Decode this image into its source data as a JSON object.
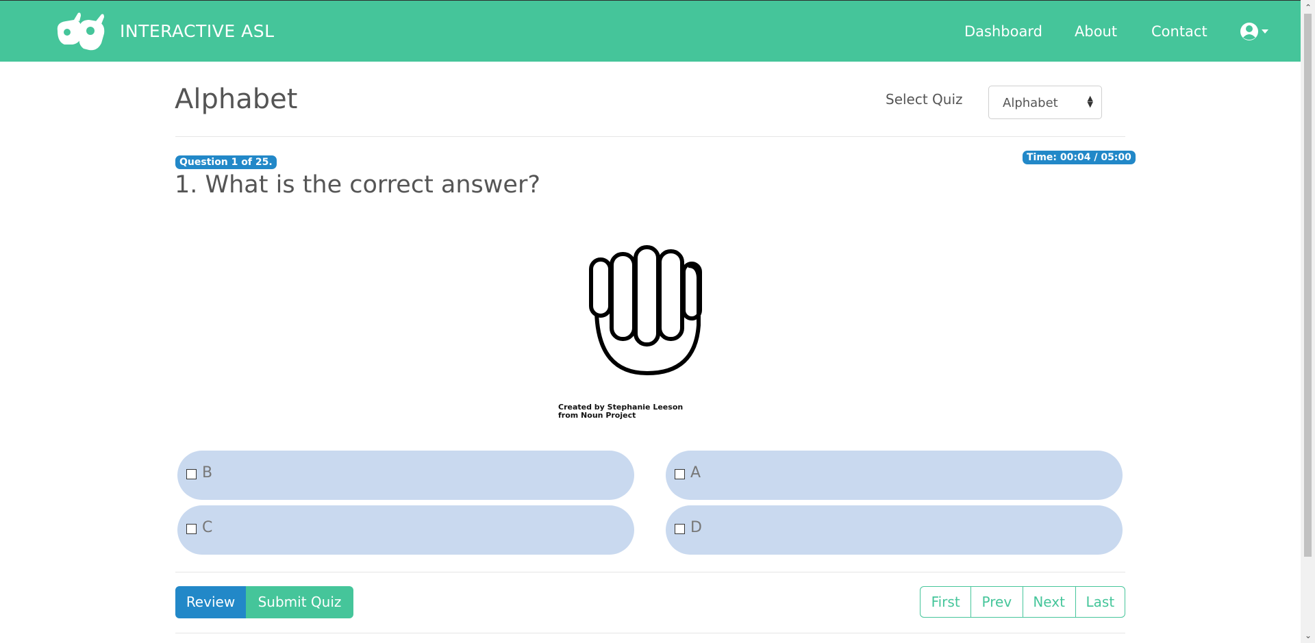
{
  "nav": {
    "brand": "INTERACTIVE ASL",
    "links": [
      "Dashboard",
      "About",
      "Contact"
    ],
    "user_icon": "user-circle-icon"
  },
  "quiz": {
    "title": "Alphabet",
    "select_label": "Select Quiz",
    "selected": "Alphabet",
    "question_badge": "Question 1 of 25.",
    "timer": "Time: 00:04 / 05:00",
    "question": "1. What is the correct answer?",
    "image_icon": "fist-hand-icon",
    "credit_line1": "Created by Stephanie Leeson",
    "credit_line2": "from Noun Project",
    "answers": [
      {
        "label": "B"
      },
      {
        "label": "A"
      },
      {
        "label": "C"
      },
      {
        "label": "D"
      }
    ]
  },
  "actions": {
    "review": "Review",
    "submit": "Submit Quiz"
  },
  "pager": {
    "first": "First",
    "prev": "Prev",
    "next": "Next",
    "last": "Last"
  },
  "colors": {
    "brand_green": "#45c59a",
    "accent_blue": "#2288c8",
    "answer_bg": "#c9d9ef"
  }
}
